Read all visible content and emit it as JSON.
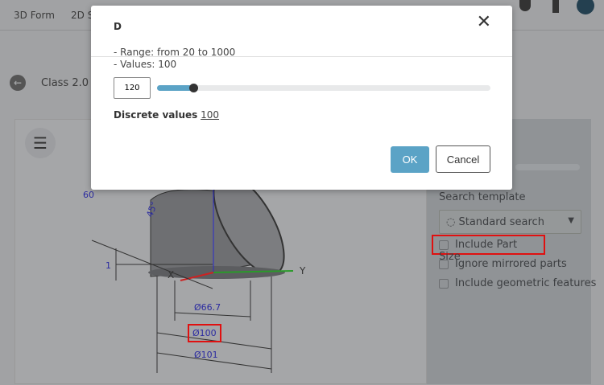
{
  "toolbar": {
    "tabs": [
      "3D Form",
      "2D S"
    ]
  },
  "breadcrumb": {
    "label": "Class 2.0 o"
  },
  "viewer": {
    "dims": {
      "d60": "60",
      "angle": "45°",
      "d1": "1",
      "d66": "Ø66.7",
      "d100": "Ø100",
      "d101": "Ø101"
    },
    "axes": {
      "x": "X",
      "y": "Y"
    }
  },
  "right_panel": {
    "search_template_label": "Search template",
    "search_template_value": "Standard search",
    "options": [
      {
        "label": "Include Part Size",
        "checked": false
      },
      {
        "label": "Ignore mirrored parts",
        "checked": false
      },
      {
        "label": "Include geometric features",
        "checked": false
      }
    ]
  },
  "modal": {
    "title": "D",
    "range_text": "- Range: from 20 to 1000",
    "values_text": "- Values: 100",
    "input_value": "120",
    "slider_fraction": 0.1,
    "discrete_label": "Discrete values",
    "discrete_value": "100",
    "ok_label": "OK",
    "cancel_label": "Cancel"
  },
  "colors": {
    "accent": "#5ba3c6",
    "highlight": "#e01010"
  }
}
